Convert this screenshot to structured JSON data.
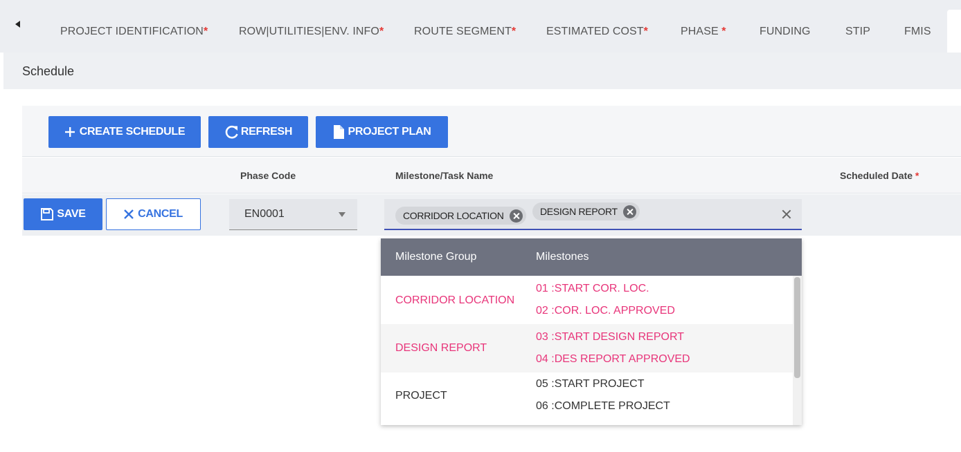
{
  "tabs": [
    {
      "label": "PROJECT IDENTIFICATION",
      "required": "*"
    },
    {
      "label": "ROW|UTILITIES|ENV. INFO",
      "required": "*"
    },
    {
      "label": "ROUTE SEGMENT",
      "required": "*"
    },
    {
      "label": "ESTIMATED COST",
      "required": "*"
    },
    {
      "label": "PHASE ",
      "required": "*"
    },
    {
      "label": "FUNDING",
      "required": ""
    },
    {
      "label": "STIP",
      "required": ""
    },
    {
      "label": "FMIS",
      "required": ""
    }
  ],
  "section": {
    "title": "Schedule"
  },
  "toolbar": {
    "create_label": "CREATE SCHEDULE",
    "refresh_label": "REFRESH",
    "plan_label": "PROJECT PLAN"
  },
  "grid": {
    "columns": {
      "phase_code": "Phase Code",
      "milestone": "Milestone/Task Name",
      "scheduled_date": "Scheduled Date",
      "required_mark": "*"
    }
  },
  "edit_row": {
    "save_label": "SAVE",
    "cancel_label": "CANCEL",
    "phase_value": "EN0001",
    "chips": [
      "CORRIDOR LOCATION",
      "DESIGN REPORT"
    ]
  },
  "dropdown": {
    "headers": {
      "group": "Milestone Group",
      "milestones": "Milestones"
    },
    "rows": [
      {
        "group": "CORRIDOR LOCATION",
        "milestones": [
          "01 :START COR. LOC.",
          "02 :COR. LOC. APPROVED"
        ],
        "selected": true
      },
      {
        "group": "DESIGN REPORT",
        "milestones": [
          "03 :START DESIGN REPORT",
          "04 :DES REPORT APPROVED"
        ],
        "selected": true
      },
      {
        "group": "PROJECT",
        "milestones": [
          "05 :START PROJECT",
          "06 :COMPLETE PROJECT"
        ],
        "selected": false
      }
    ]
  },
  "colors": {
    "primary": "#3673e0",
    "selected_text": "#e8357a",
    "required": "#e53935",
    "dropdown_header": "#6e7280"
  }
}
